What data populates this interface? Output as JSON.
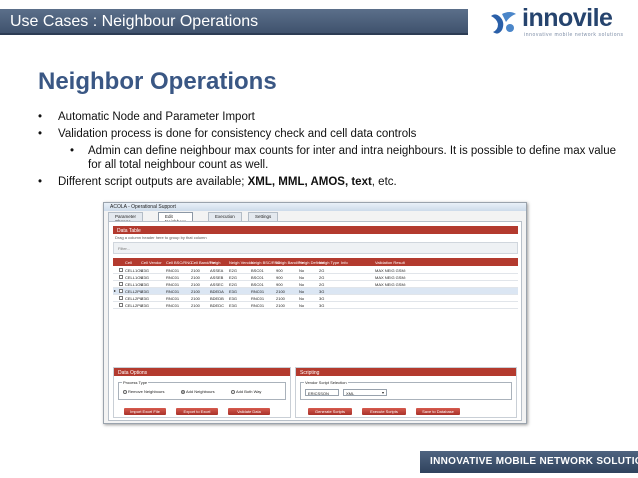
{
  "header": {
    "section_title": "Use Cases : Neighbour Operations",
    "logo_name": "innovile",
    "logo_tagline": "innovative mobile network solutions",
    "logo_icon": "innovile-bird-logo"
  },
  "slide": {
    "heading": "Neighbor Operations",
    "bullets": [
      "Automatic Node and Parameter Import",
      "Validation process is done for consistency check and cell data controls"
    ],
    "sub_bullet": "Admin can define neighbour max counts for inter and intra neighbours. It is possible to define max value for all total neighbour count as well.",
    "bullet3_prefix": "Different script outputs are available; ",
    "bullet3_bold": "XML, MML, AMOS, text",
    "bullet3_suffix": ", etc.",
    "bullet_glyph": "•"
  },
  "app": {
    "window_title": "ACOLA - Operational Support",
    "tabs": [
      "Parameter Change",
      "Edit Neighbour",
      "Execution",
      "Settings"
    ],
    "active_tab": "Edit Neighbour",
    "data_table_title": "Data Table",
    "group_hint": "Drag a column header here to group by that column",
    "filter_placeholder": "Filter...",
    "columns": [
      "Cell",
      "Cell Vendor",
      "Cell BSC/RNC",
      "Cell Band/Fre",
      "Neigh",
      "Neigh Vendor",
      "Neigh BSC/RNC",
      "Neigh Band/Fre",
      "Neigh Defined",
      "Neigh Type",
      "Info",
      "Validation Result"
    ],
    "rows": [
      [
        "CELL1OU",
        "E3G",
        "RNC01",
        "2100",
        "ASSEA",
        "E2G",
        "BSC01",
        "900",
        "No",
        "2G",
        "",
        "MAX NEIG GSM:"
      ],
      [
        "CELL1OU",
        "E3G",
        "RNC01",
        "2100",
        "ASSEB",
        "E2G",
        "BSC01",
        "900",
        "No",
        "2G",
        "",
        "MAX NEIG GSM:"
      ],
      [
        "CELL1OU",
        "E3G",
        "RNC01",
        "2100",
        "ASSEC",
        "E2G",
        "BSC01",
        "900",
        "No",
        "2G",
        "",
        "MAX NEIG GSM:"
      ],
      [
        "CELL2PU",
        "E3G",
        "RNC01",
        "2100",
        "BDEDA",
        "E3G",
        "RNC01",
        "2100",
        "No",
        "3G",
        "",
        ""
      ],
      [
        "CELL2PU",
        "E3G",
        "RNC01",
        "2100",
        "BDEDB",
        "E3G",
        "RNC01",
        "2100",
        "No",
        "3G",
        "",
        ""
      ],
      [
        "CELL2PU",
        "E3G",
        "RNC01",
        "2100",
        "BDEDC",
        "E3G",
        "RNC01",
        "2100",
        "No",
        "3G",
        "",
        ""
      ]
    ],
    "selected_row": 3,
    "data_options": {
      "title": "Data Options",
      "process_type_label": "Process Type",
      "options": [
        "Remove Neighbours",
        "Add Neighbours",
        "Add Both Way"
      ],
      "selected_option": "Add Neighbours",
      "buttons": [
        "Import Excel File",
        "Export to Excel",
        "Validate Data"
      ]
    },
    "scripting": {
      "title": "Scripting",
      "vendor_label": "Vendor Script Selection",
      "vendor_value": "ERICSSON",
      "format_value": "XML",
      "buttons": [
        "Generate Scripts",
        "Execute Scripts",
        "Save to Database"
      ]
    }
  },
  "footer": {
    "text": "INNOVATIVE MOBILE NETWORK SOLUTIONS"
  },
  "colors": {
    "header_bar": "#4a5d78",
    "heading": "#3a5784",
    "grid_header": "#b33a2e",
    "footer_bar": "#3f526d"
  }
}
